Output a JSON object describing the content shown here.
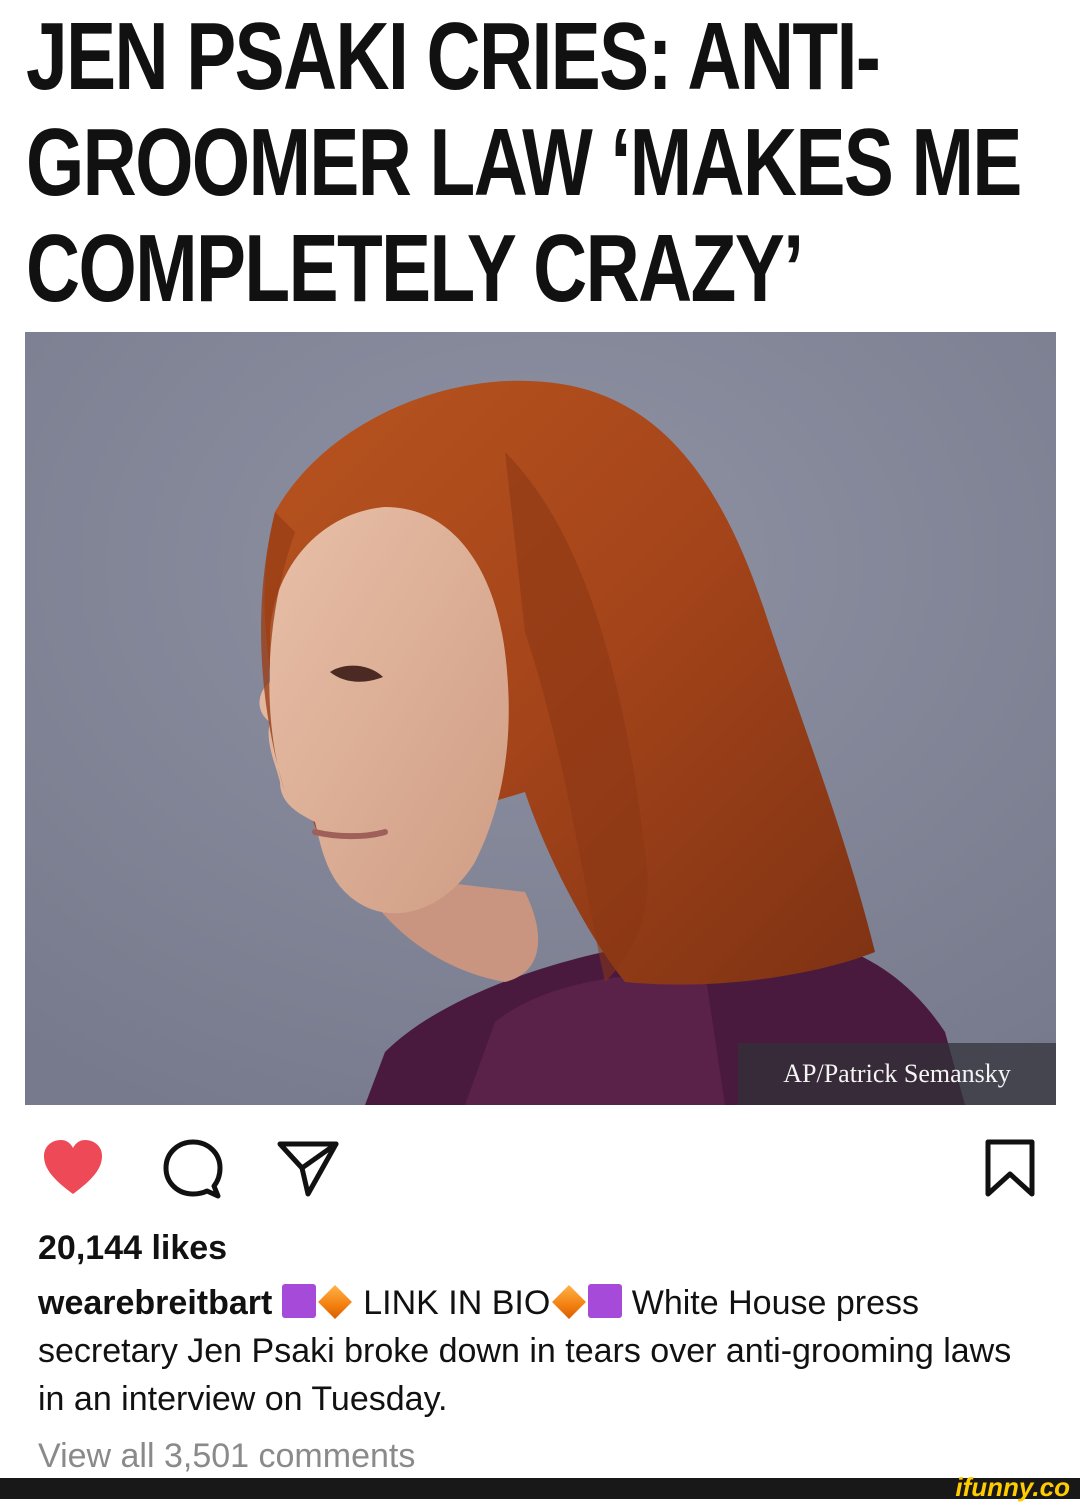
{
  "headline": {
    "line1": "JEN PSAKI CRIES: ANTI-",
    "line2": "GROOMER LAW ‘MAKES ME",
    "line3": "COMPLETELY CRAZY’"
  },
  "photo": {
    "credit": "AP/Patrick Semansky"
  },
  "actions": {
    "like_icon": "heart-filled-icon",
    "comment_icon": "comment-bubble-icon",
    "share_icon": "paper-plane-icon",
    "save_icon": "bookmark-icon",
    "like_color": "#ed4956"
  },
  "post": {
    "likes": "20,144 likes",
    "username": "wearebreitbart",
    "caption_part1": "LINK IN BIO",
    "caption_part2": "White House press secretary Jen Psaki broke down in tears over anti-grooming laws in an interview on Tuesday.",
    "view_comments": "View all 3,501 comments"
  },
  "watermark": "ifunny.co"
}
